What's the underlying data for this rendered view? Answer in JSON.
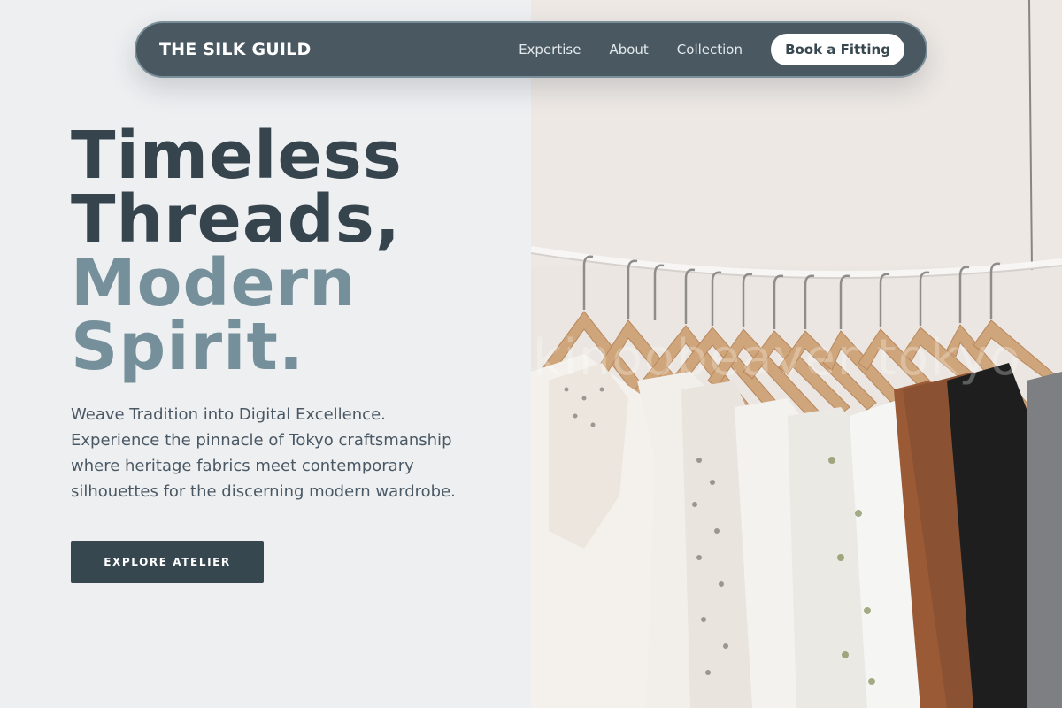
{
  "nav": {
    "brand": "THE SILK GUILD",
    "links": [
      "Expertise",
      "About",
      "Collection"
    ],
    "cta": "Book a Fitting"
  },
  "hero": {
    "headline_dark": [
      "Timeless",
      "Threads,"
    ],
    "headline_light": [
      "Modern",
      "Spirit."
    ],
    "lead_lines": [
      "Weave Tradition into Digital Excellence.",
      "Experience the pinnacle of Tokyo craftsmanship",
      "where heritage fabrics meet contemporary",
      "silhouettes for the discerning modern wardrobe."
    ],
    "cta": "EXPLORE ATELIER"
  },
  "image": {
    "watermark": "kinoobeaver tokyo"
  },
  "colors": {
    "accent_dark": "#37474f",
    "accent_light": "#76909b",
    "nav_bg": "#4a5961",
    "page_bg": "#edeff1"
  }
}
